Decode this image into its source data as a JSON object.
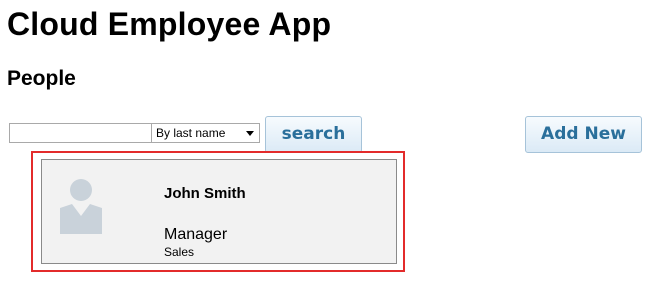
{
  "app": {
    "title": "Cloud Employee App"
  },
  "section": {
    "title": "People"
  },
  "search": {
    "value": "",
    "placeholder": "",
    "sort_selected": "By last name",
    "button_label": "search"
  },
  "toolbar": {
    "add_new_label": "Add New"
  },
  "results": [
    {
      "name": "John Smith",
      "title": "Manager",
      "department": "Sales",
      "avatar_icon": "person-icon"
    }
  ],
  "colors": {
    "highlight_border": "#e32b2b",
    "button_text": "#2a6f9b",
    "avatar_fill": "#c9d2da",
    "card_background": "#f2f2f2"
  }
}
